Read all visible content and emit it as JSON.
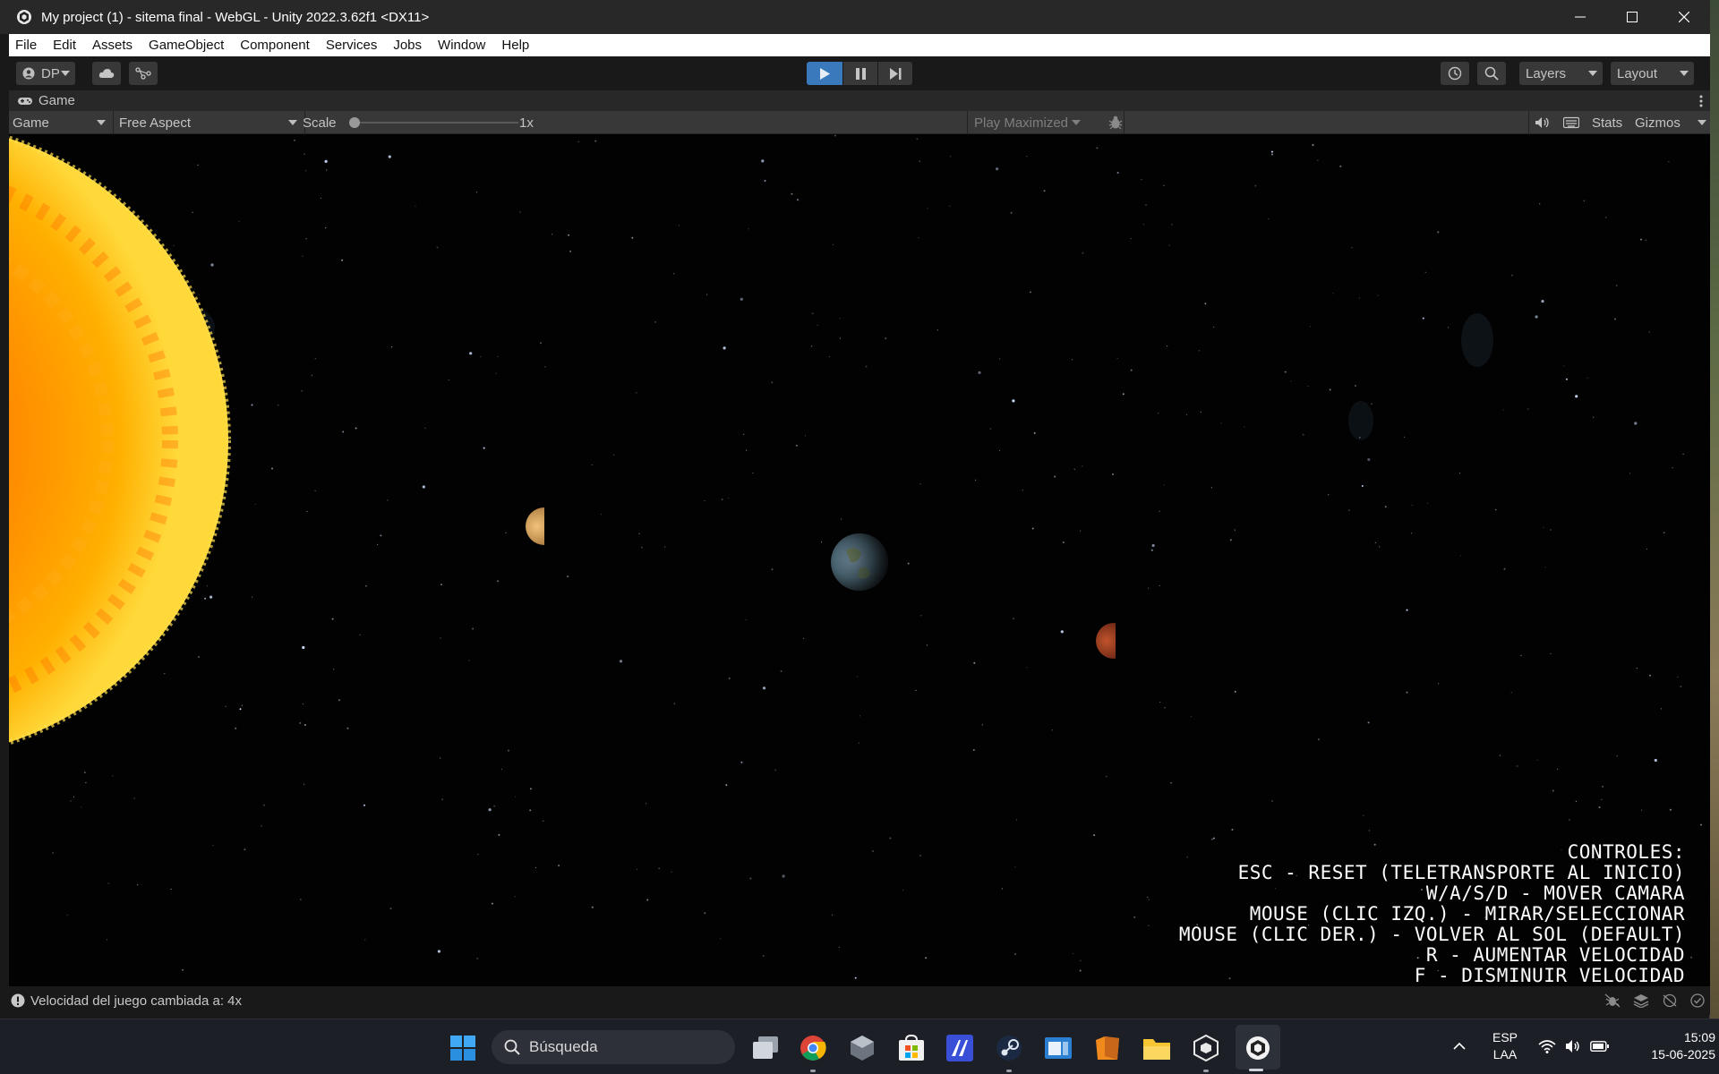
{
  "window": {
    "title": "My project (1) - sitema final - WebGL - Unity 2022.3.62f1 <DX11>"
  },
  "menu": [
    "File",
    "Edit",
    "Assets",
    "GameObject",
    "Component",
    "Services",
    "Jobs",
    "Window",
    "Help"
  ],
  "toolbar": {
    "account_label": "DP",
    "layers_label": "Layers",
    "layout_label": "Layout"
  },
  "game_tab": {
    "tab_label": "Game",
    "display_dropdown": "Game",
    "aspect_dropdown": "Free Aspect",
    "scale_label": "Scale",
    "scale_value": "1x",
    "play_mode_dropdown": "Play Maximized",
    "stats_label": "Stats",
    "gizmos_label": "Gizmos"
  },
  "game_view": {
    "controls_lines": [
      "CONTROLES:",
      "ESC - RESET (TELETRANSPORTE AL INICIO)",
      "W/A/S/D - MOVER CAMARA",
      "MOUSE (CLIC IZQ.) - MIRAR/SELECCIONAR",
      "MOUSE (CLIC DER.) - VOLVER AL SOL (DEFAULT)",
      "R - AUMENTAR VELOCIDAD",
      "F - DISMINUIR VELOCIDAD"
    ]
  },
  "status_bar": {
    "message": "Velocidad del juego cambiada a: 4x"
  },
  "taskbar": {
    "search_placeholder": "Búsqueda",
    "language": "ESP",
    "keyboard": "LAA",
    "time": "15:09",
    "date": "15-06-2025"
  },
  "colors": {
    "unity_dark": "#191919",
    "play_active": "#3a79bb",
    "sun": "#ff9a0a"
  }
}
